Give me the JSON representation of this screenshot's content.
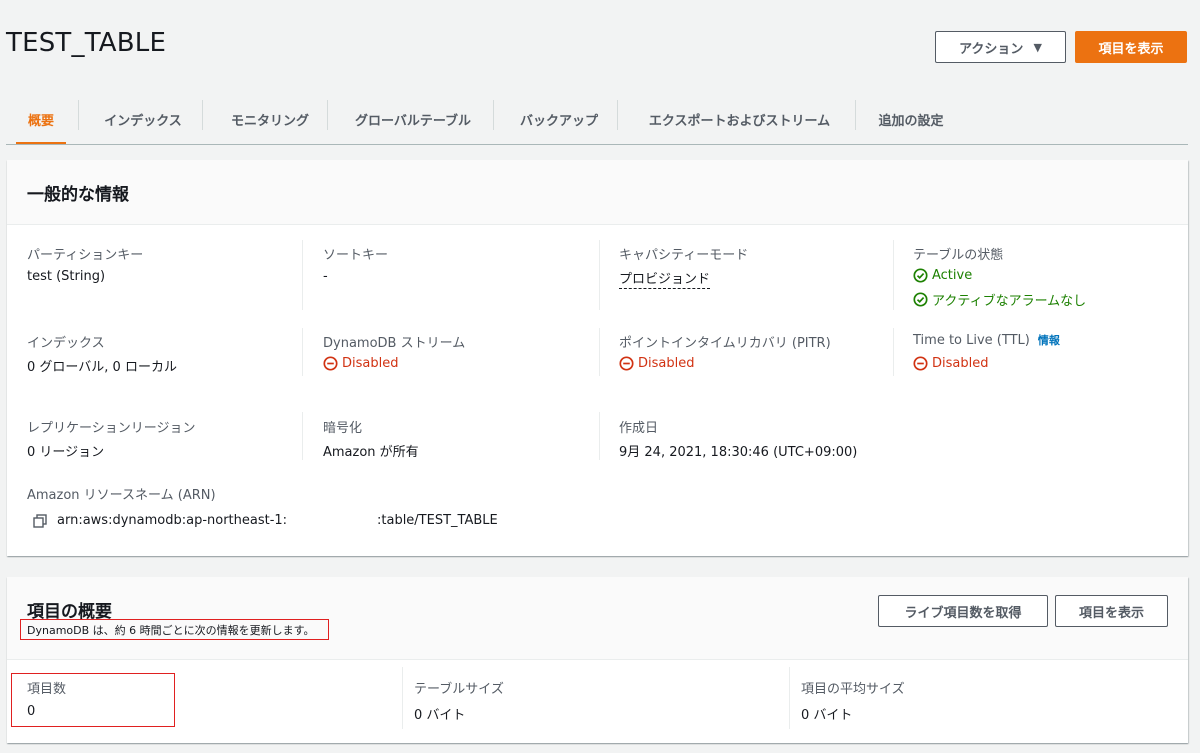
{
  "header": {
    "title": "TEST_TABLE",
    "actions_label": "アクション",
    "view_items_label": "項目を表示"
  },
  "tabs": [
    {
      "label": "概要",
      "active": true
    },
    {
      "label": "インデックス"
    },
    {
      "label": "モニタリング"
    },
    {
      "label": "グローバルテーブル"
    },
    {
      "label": "バックアップ"
    },
    {
      "label": "エクスポートおよびストリーム"
    },
    {
      "label": "追加の設定"
    }
  ],
  "general": {
    "title": "一般的な情報",
    "partition_key": {
      "label": "パーティションキー",
      "value": "test (String)"
    },
    "sort_key": {
      "label": "ソートキー",
      "value": "-"
    },
    "capacity_mode": {
      "label": "キャパシティーモード",
      "value": "プロビジョンド"
    },
    "table_status": {
      "label": "テーブルの状態",
      "value": "Active",
      "alarm": "アクティブなアラームなし"
    },
    "indexes": {
      "label": "インデックス",
      "value": "0 グローバル, 0 ローカル"
    },
    "streams": {
      "label": "DynamoDB ストリーム",
      "value": "Disabled"
    },
    "pitr": {
      "label": "ポイントインタイムリカバリ (PITR)",
      "value": "Disabled"
    },
    "ttl": {
      "label": "Time to Live (TTL)",
      "info": "情報",
      "value": "Disabled"
    },
    "replication": {
      "label": "レプリケーションリージョン",
      "value": "0 リージョン"
    },
    "encryption": {
      "label": "暗号化",
      "value": "Amazon が所有"
    },
    "created": {
      "label": "作成日",
      "value": "9月 24, 2021, 18:30:46 (UTC+09:00)"
    },
    "arn": {
      "label": "Amazon リソースネーム (ARN)",
      "value_prefix": "arn:aws:dynamodb:ap-northeast-1:",
      "value_suffix": ":table/TEST_TABLE"
    }
  },
  "summary": {
    "title": "項目の概要",
    "note": "DynamoDB は、約 6 時間ごとに次の情報を更新します。",
    "live_count_label": "ライブ項目数を取得",
    "view_items_label": "項目を表示",
    "item_count": {
      "label": "項目数",
      "value": "0"
    },
    "table_size": {
      "label": "テーブルサイズ",
      "value": "0 バイト"
    },
    "avg_item_size": {
      "label": "項目の平均サイズ",
      "value": "0 バイト"
    }
  },
  "colors": {
    "accent": "#ec7211",
    "success": "#1d8102",
    "error": "#d13212",
    "link": "#0073bb",
    "highlight_box": "#e02020"
  },
  "icons": {
    "status_ok": "check-circle-icon",
    "status_disabled": "minus-circle-icon",
    "copy": "copy-icon",
    "dropdown": "caret-down-icon"
  }
}
